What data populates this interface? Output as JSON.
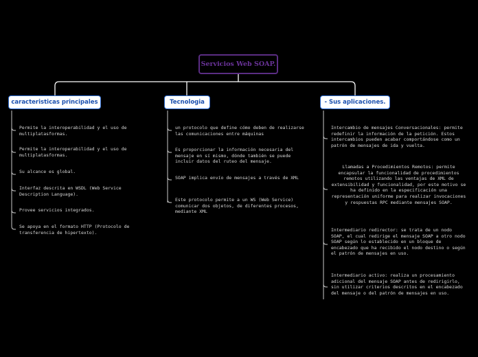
{
  "title": "Servicios Web SOAP.",
  "branches": [
    {
      "label": "caracteristicas principales",
      "items": [
        "Permite la interoperabilidad y el uso de multiplatasformas.",
        "Permite la interoperabilidad y el uso de multiplatasformas.",
        "Su alcance es global.",
        "Interfaz descrita en WSDL (Web Service Description Language).",
        "Provee servicios integrados.",
        "Se apoya en el formato HTTP (Protocolo de transferencia de hipertexto)."
      ]
    },
    {
      "label": "Tecnologia",
      "items": [
        "un protocolo que define cómo deben de realizarse las comunicaciones entre máquinas",
        "Es proporcionar la información necesaria del mensaje en sí mismo, dónde también se puede incluir datos del ruteo del mensaje.",
        "SOAP implica envío de mensajes a través de XML",
        "Este protocolo permite a un WS (Web Service) comunicar dos objetos, de diferentes procesos, mediante XML"
      ]
    },
    {
      "label": "- Sus aplicaciones.",
      "items": [
        "Intercambio de mensajes Conversacionales: permite redefinir la información de la petición. Estos intercambios pueden acabar comportándose como un patrón de mensajes de ida y vuelta.",
        "Llamadas a Procedimientos Remotos: permite encapsular la funcionalidad de procedimientos remotos utilizando las ventajas de XML de extensibilidad y funcionalidad, por este motivo se ha definido en la especificación una representación uniforme para realizar invocaciones y respuestas RPC mediante mensajes SOAP.",
        "Intermediario redirector: se trata de un nodo SOAP, el cual redirige el mensaje SOAP a otro nodo SOAP según lo establecido en un bloque de encabezado que ha recibido el nodo destino o según el patrón de mensajes en uso.",
        "Intermediario activo: realiza un procesamiento adicional del mensaje SOAP antes de redirigirlo, sin utilizar criterios descritos en el encabezado del mensaje o del patrón de mensajes en uso."
      ]
    }
  ]
}
